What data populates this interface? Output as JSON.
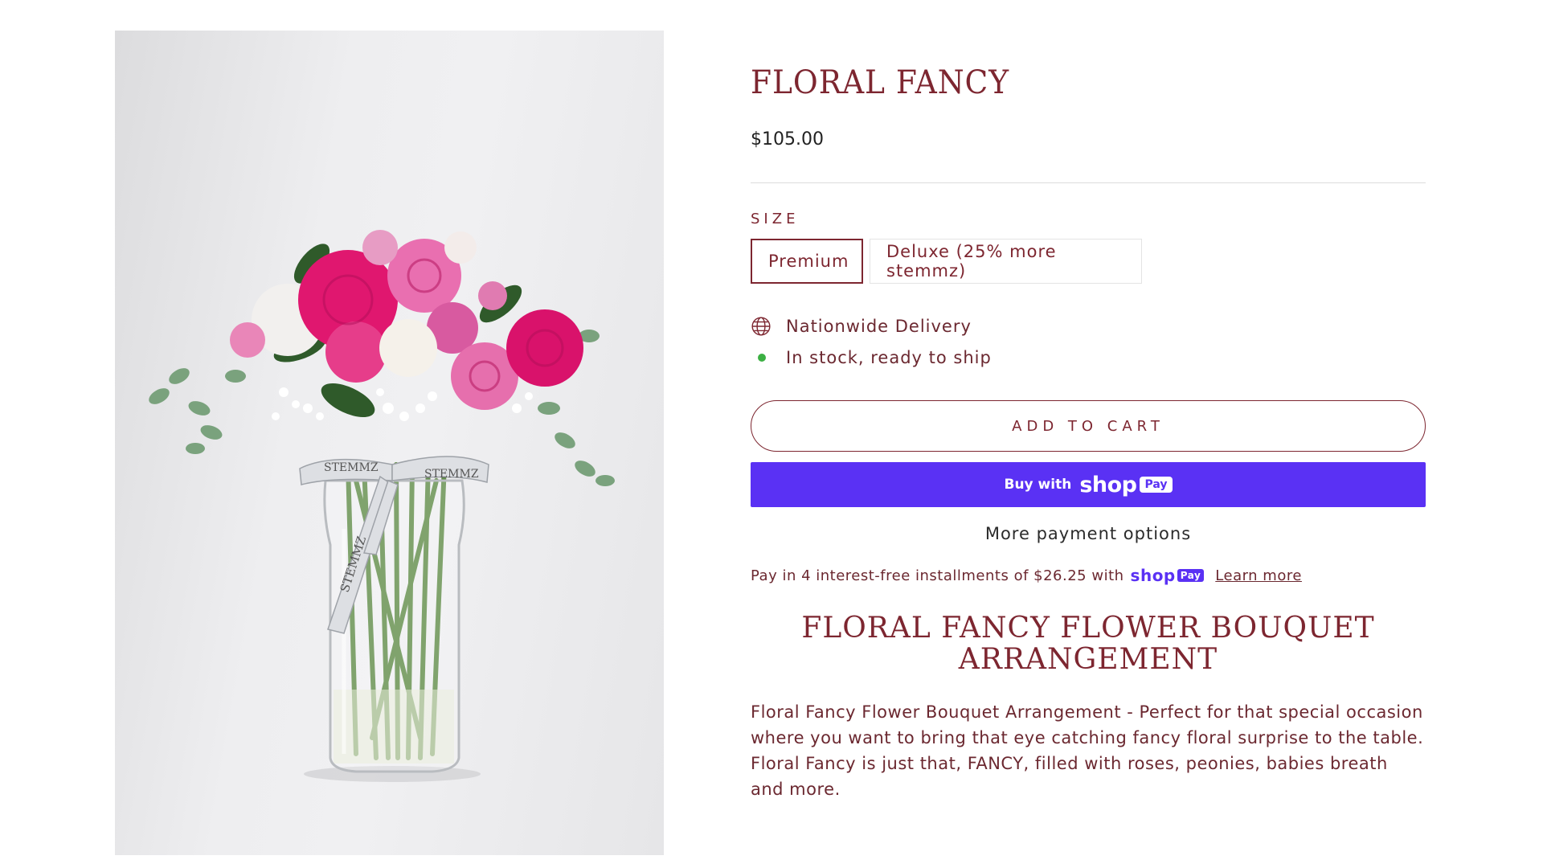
{
  "product": {
    "title": "FLORAL FANCY",
    "price": "$105.00",
    "image_description": "Bouquet of pink peonies, roses and baby's breath in a glass jar tied with a STEMMZ ribbon",
    "ribbon_text": "STEMMZ"
  },
  "size": {
    "label": "SIZE",
    "options": [
      {
        "label": "Premium",
        "selected": true
      },
      {
        "label": "Deluxe (25% more stemmz)",
        "selected": false
      }
    ]
  },
  "delivery": {
    "icon": "globe-icon",
    "text": "Nationwide Delivery"
  },
  "stock": {
    "icon": "status-dot",
    "text": "In stock, ready to ship",
    "color": "#3cb043"
  },
  "buttons": {
    "add_to_cart": "ADD TO CART",
    "buy_with": "Buy with",
    "shop_word": "shop",
    "pay_badge": "Pay",
    "more_payment": "More payment options"
  },
  "installments": {
    "text": "Pay in 4 interest-free installments of $26.25 with",
    "shop": "shop",
    "pay": "Pay",
    "learn_more": "Learn more"
  },
  "description": {
    "title_line1": "FLORAL FANCY FLOWER BOUQUET",
    "title_line2": "ARRANGEMENT",
    "body": "Floral Fancy Flower Bouquet Arrangement - Perfect for that special occasion where you want to bring that eye catching fancy floral surprise to the table. Floral Fancy is just that, FANCY, filled with roses, peonies, babies breath and more."
  },
  "colors": {
    "brand": "#7d2630",
    "shop_pay": "#5a31f4",
    "in_stock": "#3cb043"
  }
}
